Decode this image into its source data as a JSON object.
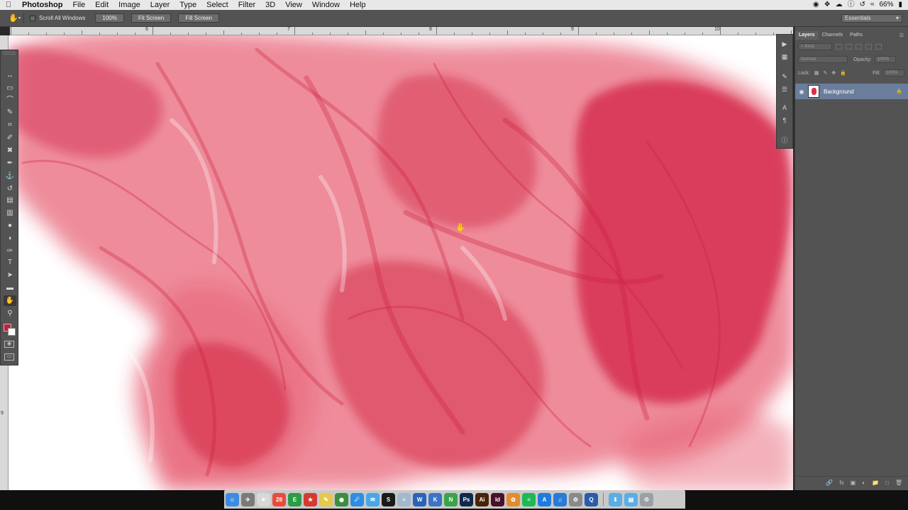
{
  "menubar": {
    "apple": "",
    "items": [
      {
        "label": "Photoshop",
        "app": true
      },
      {
        "label": "File"
      },
      {
        "label": "Edit"
      },
      {
        "label": "Image"
      },
      {
        "label": "Layer"
      },
      {
        "label": "Type"
      },
      {
        "label": "Select"
      },
      {
        "label": "Filter"
      },
      {
        "label": "3D"
      },
      {
        "label": "View"
      },
      {
        "label": "Window"
      },
      {
        "label": "Help"
      }
    ],
    "status": {
      "battery": "66%",
      "icons": [
        "record-icon",
        "dropbox-icon",
        "creative-cloud-icon",
        "info-icon",
        "time-machine-icon",
        "wifi-icon",
        "battery-icon"
      ]
    }
  },
  "options_bar": {
    "tool_icon": "hand-tool-icon",
    "scroll_all_windows": "Scroll All Windows",
    "zoom_100": "100%",
    "fit_screen": "Fit Screen",
    "fill_screen": "Fill Screen",
    "workspace": "Essentials"
  },
  "rulers": {
    "top_labels": [
      "6",
      "7",
      "8",
      "9",
      "10"
    ],
    "left_labels": [
      "9"
    ]
  },
  "tools": [
    {
      "name": "move-tool",
      "glyph": "↔"
    },
    {
      "name": "marquee-tool",
      "glyph": "▭"
    },
    {
      "name": "lasso-tool",
      "glyph": "⌒"
    },
    {
      "name": "quick-select-tool",
      "glyph": "✎"
    },
    {
      "name": "crop-tool",
      "glyph": "⌗"
    },
    {
      "name": "eyedropper-tool",
      "glyph": "✐"
    },
    {
      "name": "healing-brush-tool",
      "glyph": "✖"
    },
    {
      "name": "brush-tool",
      "glyph": "✒"
    },
    {
      "name": "clone-stamp-tool",
      "glyph": "⚓"
    },
    {
      "name": "history-brush-tool",
      "glyph": "↺"
    },
    {
      "name": "eraser-tool",
      "glyph": "▤"
    },
    {
      "name": "gradient-tool",
      "glyph": "▥"
    },
    {
      "name": "blur-tool",
      "glyph": "●"
    },
    {
      "name": "dodge-tool",
      "glyph": "◖"
    },
    {
      "name": "pen-tool",
      "glyph": "✑"
    },
    {
      "name": "type-tool",
      "glyph": "T"
    },
    {
      "name": "path-select-tool",
      "glyph": "➤"
    },
    {
      "name": "shape-tool",
      "glyph": "▬"
    },
    {
      "name": "hand-tool",
      "glyph": "✋",
      "active": true
    },
    {
      "name": "zoom-tool",
      "glyph": "⚲"
    }
  ],
  "colors": {
    "foreground": "#c7203b",
    "background": "#ffffff",
    "ink": "#e0304c",
    "ink_dark": "#cf1d3d",
    "selected_layer": "#6a7e9b"
  },
  "layers_panel": {
    "tabs": [
      "Layers",
      "Channels",
      "Paths"
    ],
    "active_tab": "Layers",
    "filter_label": "⌕ Kind",
    "blend_mode": "Normal",
    "opacity_label": "Opacity:",
    "opacity_value": "100%",
    "lock_label": "Lock:",
    "fill_label": "Fill:",
    "fill_value": "100%",
    "layers": [
      {
        "name": "Background",
        "visible": true,
        "locked": true
      }
    ]
  },
  "dock": {
    "apps": [
      {
        "name": "finder",
        "label": "☺",
        "color": "#3d8be0"
      },
      {
        "name": "launchpad",
        "label": "✈",
        "color": "#7a7a7a"
      },
      {
        "name": "safari-compass",
        "label": "✴",
        "color": "#d8d8d8"
      },
      {
        "name": "calendar",
        "label": "28",
        "color": "#e84c3d"
      },
      {
        "name": "evernote",
        "label": "E",
        "color": "#2c9c45"
      },
      {
        "name": "wunderlist",
        "label": "★",
        "color": "#d43b2f"
      },
      {
        "name": "notes",
        "label": "✎",
        "color": "#e6c84a"
      },
      {
        "name": "chrome",
        "label": "◉",
        "color": "#3c8d3e"
      },
      {
        "name": "safari",
        "label": "☄",
        "color": "#2e8de0"
      },
      {
        "name": "messages",
        "label": "✉",
        "color": "#4aa6e8"
      },
      {
        "name": "skype",
        "label": "S",
        "color": "#1a1a1a"
      },
      {
        "name": "textwrangler",
        "label": "≡",
        "color": "#a2b8cf"
      },
      {
        "name": "word",
        "label": "W",
        "color": "#2a63b8"
      },
      {
        "name": "keynote",
        "label": "K",
        "color": "#3a74c7"
      },
      {
        "name": "numbers",
        "label": "N",
        "color": "#3aa44a"
      },
      {
        "name": "photoshop",
        "label": "Ps",
        "color": "#0e2a4a"
      },
      {
        "name": "illustrator",
        "label": "Ai",
        "color": "#4a2308"
      },
      {
        "name": "indesign",
        "label": "Id",
        "color": "#4a0f2b"
      },
      {
        "name": "photos",
        "label": "✿",
        "color": "#e68a2e"
      },
      {
        "name": "spotify",
        "label": "≡",
        "color": "#1eb954"
      },
      {
        "name": "app-store",
        "label": "A",
        "color": "#1f7be0"
      },
      {
        "name": "itunes",
        "label": "♫",
        "color": "#2a7ad8"
      },
      {
        "name": "system-preferences",
        "label": "⚙",
        "color": "#8a8a8a"
      },
      {
        "name": "quicktime",
        "label": "Q",
        "color": "#2a5caa"
      },
      {
        "name": "downloads-folder",
        "label": "⬇",
        "color": "#5aaee6"
      },
      {
        "name": "documents-folder",
        "label": "▤",
        "color": "#5aaee6"
      },
      {
        "name": "trash",
        "label": "♲",
        "color": "#9aa0a6"
      }
    ]
  }
}
